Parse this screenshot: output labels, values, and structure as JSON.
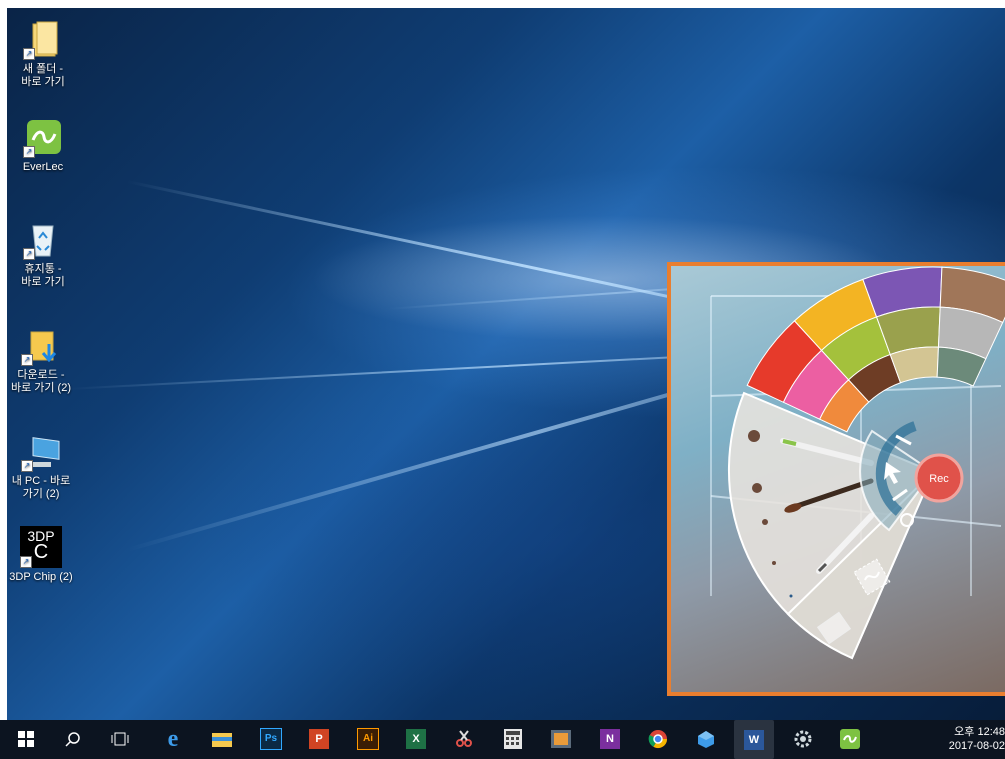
{
  "desktop_icons": [
    {
      "label": "새 폴더 -\n바로 가기",
      "icon": "folder-icon"
    },
    {
      "label": "EverLec",
      "icon": "everlec-icon"
    },
    {
      "label": "휴지통 -\n바로 가기",
      "icon": "recycle-bin-icon"
    },
    {
      "label": "다운로드 -\n바로 가기 (2)",
      "icon": "downloads-folder-icon"
    },
    {
      "label": "내 PC - 바로\n가기 (2)",
      "icon": "this-pc-icon"
    },
    {
      "label": "3DP Chip (2)",
      "icon": "3dp-chip-icon",
      "icon_text": "3DP"
    }
  ],
  "everlec_palette": {
    "record_label": "Rec",
    "colors": [
      "#e63a2b",
      "#ec5fa2",
      "#f08a3c",
      "#f3b423",
      "#a4c13c",
      "#6e3d25",
      "#7c56b4",
      "#9aa14d",
      "#d3c593",
      "#a07659",
      "#b7b7b7",
      "#6c8a7a"
    ]
  },
  "taskbar": {
    "items": [
      {
        "name": "start-button",
        "icon": "windows-logo-icon"
      },
      {
        "name": "search-button",
        "icon": "search-icon"
      },
      {
        "name": "task-view-button",
        "icon": "task-view-icon"
      },
      {
        "name": "edge-app",
        "icon": "edge-icon"
      },
      {
        "name": "file-explorer-app",
        "icon": "file-explorer-icon"
      },
      {
        "name": "photoshop-app",
        "icon": "photoshop-icon",
        "text": "Ps",
        "color": "#0b2a45"
      },
      {
        "name": "powerpoint-app",
        "icon": "powerpoint-icon",
        "text": "P",
        "color": "#d04423"
      },
      {
        "name": "illustrator-app",
        "icon": "illustrator-icon",
        "text": "Ai",
        "color": "#3b1e05"
      },
      {
        "name": "excel-app",
        "icon": "excel-icon",
        "text": "X",
        "color": "#1e7145"
      },
      {
        "name": "snipping-tool-app",
        "icon": "snipping-tool-icon"
      },
      {
        "name": "calculator-app",
        "icon": "calculator-icon"
      },
      {
        "name": "media-app",
        "icon": "media-icon"
      },
      {
        "name": "onenote-app",
        "icon": "onenote-icon",
        "text": "N",
        "color": "#7b2f9e"
      },
      {
        "name": "chrome-app",
        "icon": "chrome-icon"
      },
      {
        "name": "3d-builder-app",
        "icon": "3d-builder-icon"
      },
      {
        "name": "word-app",
        "icon": "word-icon",
        "text": "W",
        "color": "#2b579a"
      },
      {
        "name": "settings-app",
        "icon": "settings-icon"
      },
      {
        "name": "everlec-app",
        "icon": "everlec-icon"
      }
    ],
    "clock_time": "오후 12:48",
    "clock_date": "2017-08-02"
  }
}
